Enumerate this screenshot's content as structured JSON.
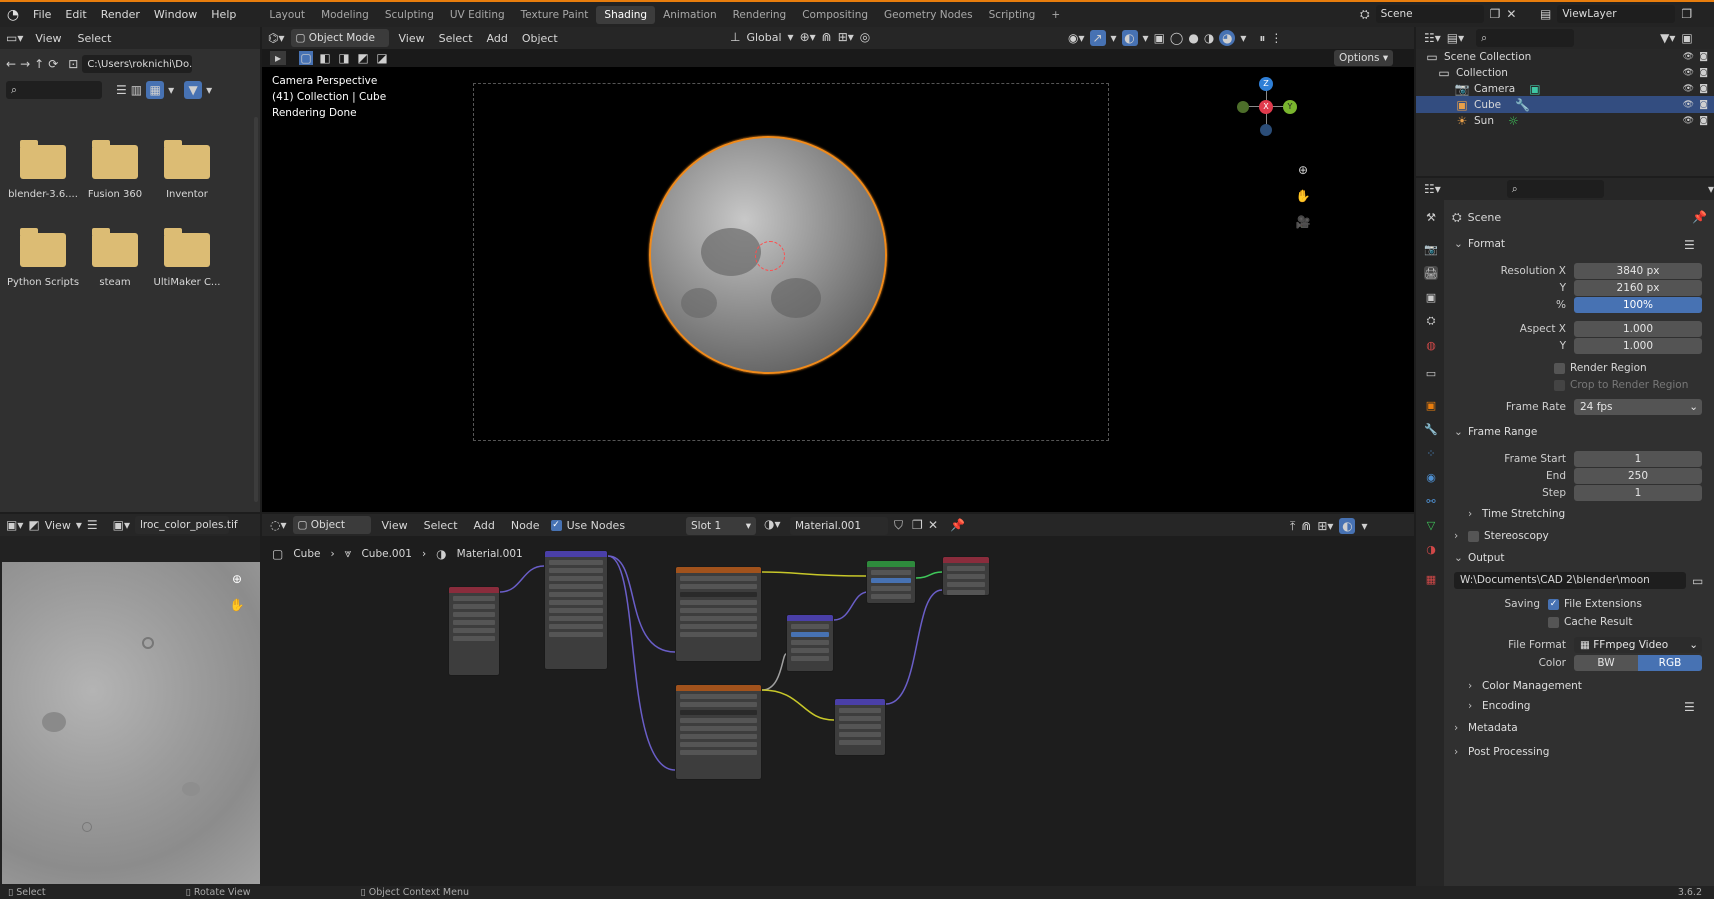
{
  "menu": [
    "File",
    "Edit",
    "Render",
    "Window",
    "Help"
  ],
  "workspaces": [
    {
      "label": "Layout",
      "active": false
    },
    {
      "label": "Modeling",
      "active": false
    },
    {
      "label": "Sculpting",
      "active": false
    },
    {
      "label": "UV Editing",
      "active": false
    },
    {
      "label": "Texture Paint",
      "active": false
    },
    {
      "label": "Shading",
      "active": true
    },
    {
      "label": "Animation",
      "active": false
    },
    {
      "label": "Rendering",
      "active": false
    },
    {
      "label": "Compositing",
      "active": false
    },
    {
      "label": "Geometry Nodes",
      "active": false
    },
    {
      "label": "Scripting",
      "active": false
    }
  ],
  "scene": {
    "name": "Scene",
    "view_layer": "ViewLayer"
  },
  "file_browser": {
    "menu": [
      "View",
      "Select"
    ],
    "path": "C:\\Users\\roknichi\\Do...",
    "folders": [
      "blender-3.6....",
      "Fusion 360",
      "Inventor",
      "Python Scripts",
      "steam",
      "UltiMaker C..."
    ]
  },
  "viewport": {
    "mode": "Object Mode",
    "menu": [
      "View",
      "Select",
      "Add",
      "Object"
    ],
    "orientation": "Global",
    "options": "Options",
    "info": [
      "Camera Perspective",
      "(41) Collection | Cube",
      "Rendering Done"
    ],
    "gizmo": {
      "x": "X",
      "y": "Y",
      "z": "Z"
    }
  },
  "image_editor": {
    "view": "View",
    "image_name": "lroc_color_poles.tif"
  },
  "node_editor": {
    "mode": "Object",
    "menu": [
      "View",
      "Select",
      "Add",
      "Node"
    ],
    "use_nodes": "Use Nodes",
    "slot": "Slot 1",
    "material": "Material.001",
    "breadcrumb": [
      "Cube",
      "Cube.001",
      "Material.001"
    ]
  },
  "outliner": {
    "root": "Scene Collection",
    "collection": "Collection",
    "items": [
      {
        "name": "Camera",
        "selected": false
      },
      {
        "name": "Cube",
        "selected": true
      },
      {
        "name": "Sun",
        "selected": false
      }
    ]
  },
  "properties": {
    "context": "Scene",
    "format_label": "Format",
    "resolution_x_label": "Resolution X",
    "resolution_x": "3840 px",
    "resolution_y_label": "Y",
    "resolution_y": "2160 px",
    "percent_label": "%",
    "percent": "100%",
    "aspect_x_label": "Aspect X",
    "aspect_x": "1.000",
    "aspect_y_label": "Y",
    "aspect_y": "1.000",
    "render_region": "Render Region",
    "crop_region": "Crop to Render Region",
    "frame_rate_label": "Frame Rate",
    "frame_rate": "24 fps",
    "frame_range_label": "Frame Range",
    "frame_start_label": "Frame Start",
    "frame_start": "1",
    "end_label": "End",
    "end": "250",
    "step_label": "Step",
    "step": "1",
    "time_stretching": "Time Stretching",
    "stereoscopy": "Stereoscopy",
    "output_label": "Output",
    "output_path": "W:\\Documents\\CAD 2\\blender\\moon",
    "saving_label": "Saving",
    "file_extensions": "File Extensions",
    "cache_result": "Cache Result",
    "file_format_label": "File Format",
    "file_format": "FFmpeg Video",
    "color_label": "Color",
    "color_bw": "BW",
    "color_rgb": "RGB",
    "color_management": "Color Management",
    "encoding": "Encoding",
    "metadata": "Metadata",
    "post_processing": "Post Processing"
  },
  "status": {
    "select": "Select",
    "rotate": "Rotate View",
    "context": "Object Context Menu",
    "version": "3.6.2"
  },
  "colors": {
    "accent": "#e87d0d",
    "selection": "#4772b3",
    "panel": "#303030",
    "header": "#262626"
  }
}
